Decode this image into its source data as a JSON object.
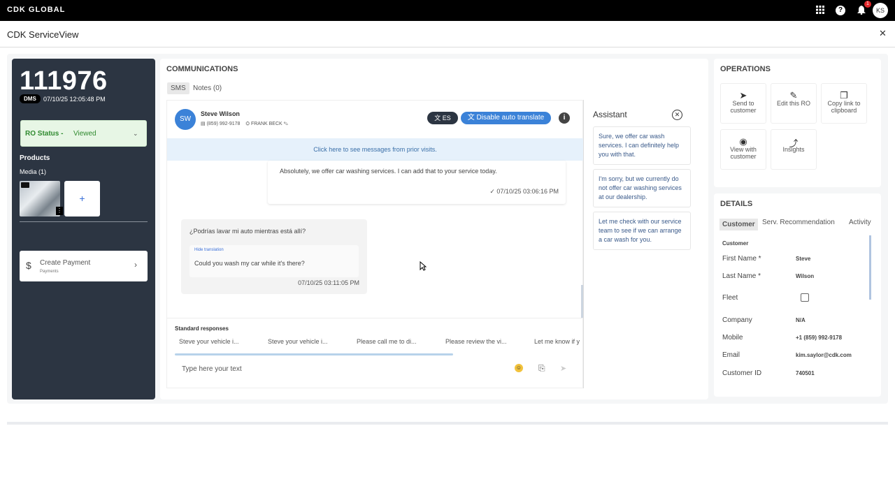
{
  "topbar": {
    "logo": "CDK GLOBAL",
    "notif_count": "1",
    "user_initials": "KS"
  },
  "app": {
    "title": "CDK ServiceView"
  },
  "ro": {
    "number": "111976",
    "dms_label": "DMS",
    "date": "07/10/25 12:05:48 PM",
    "status_label": "RO Status - ",
    "status_value": "Viewed",
    "products_label": "Products",
    "media_label": "Media (1)",
    "add_symbol": "+",
    "payment_title": "Create Payment",
    "payment_sub": "Payments"
  },
  "communications": {
    "header": "COMMUNICATIONS",
    "tabs": [
      "SMS",
      "Notes (0)"
    ],
    "contact": {
      "initials": "SW",
      "name": "Steve Wilson",
      "phone": "(859) 992-9178",
      "advisor": "FRANK BECK"
    },
    "lang_btn": "ES",
    "translate_btn": "Disable auto translate",
    "prior_visits": "Click here to see messages from prior visits.",
    "messages": [
      {
        "text": "Absolutely, we offer car washing services. I can add that to your service today.",
        "time": "07/10/25 03:06:16 PM"
      },
      {
        "text": "¿Podrías lavar mi auto mientras está allí?",
        "hide_label": "Hide translation",
        "translation": "Could you wash my car while it's there?",
        "time": "07/10/25 03:11:05 PM"
      }
    ],
    "std_responses_label": "Standard responses",
    "std_responses": [
      "Steve your vehicle i...",
      "Steve your vehicle i...",
      "Please call me to di...",
      "Please review the vi...",
      "Let me know if y"
    ],
    "input_placeholder": "Type here your text"
  },
  "assistant": {
    "title": "Assistant",
    "suggestions": [
      "Sure, we offer car wash services. I can definitely help you with that.",
      "I'm sorry, but we currently do not offer car washing services at our dealership.",
      "Let me check with our service team to see if we can arrange a car wash for you."
    ]
  },
  "operations": {
    "header": "OPERATIONS",
    "buttons": [
      "Send to customer",
      "Edit this RO",
      "Copy link to clipboard",
      "View with customer",
      "Insights"
    ]
  },
  "details": {
    "header": "DETAILS",
    "tabs": [
      "Customer",
      "Serv. Recommendation",
      "Activity"
    ],
    "section": "Customer",
    "fields": [
      {
        "label": "First Name *",
        "value": "Steve"
      },
      {
        "label": "Last Name *",
        "value": "Wilson"
      },
      {
        "label": "Fleet",
        "value": ""
      },
      {
        "label": "Company",
        "value": "N/A"
      },
      {
        "label": "Mobile",
        "value": "+1 (859) 992-9178"
      },
      {
        "label": "Email",
        "value": "kim.saylor@cdk.com"
      },
      {
        "label": "Customer ID",
        "value": "740501"
      }
    ]
  }
}
